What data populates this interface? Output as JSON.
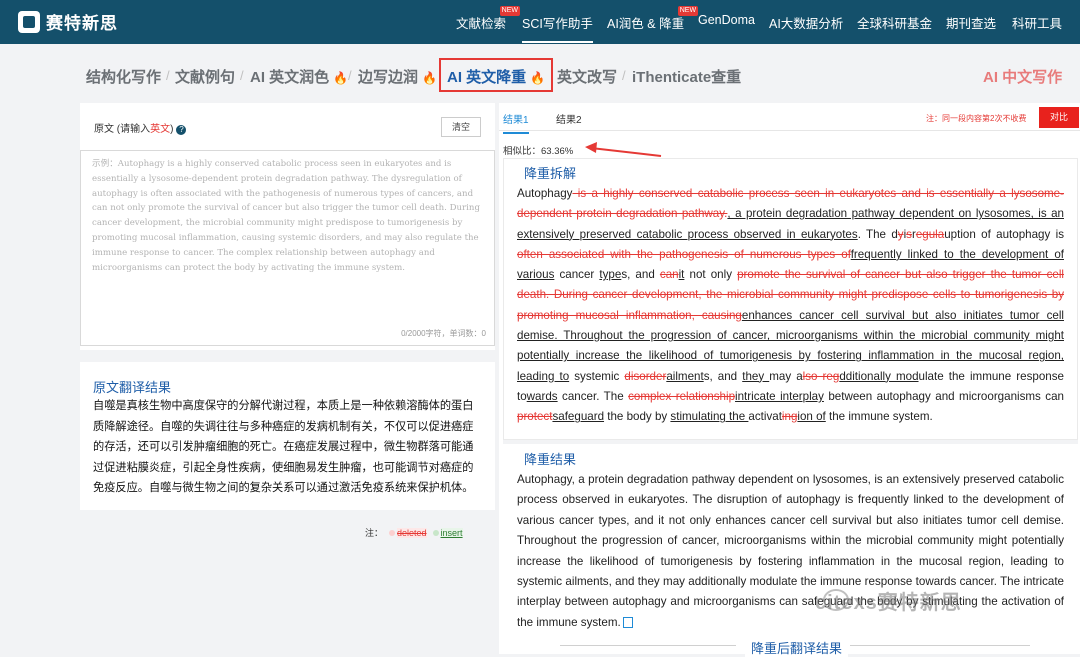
{
  "header": {
    "logo_text": "赛特新思",
    "nav": [
      {
        "label": "文献检索",
        "badge": "NEW"
      },
      {
        "label": "SCI写作助手",
        "active": true
      },
      {
        "label": "AI润色 & 降重",
        "badge": "NEW"
      },
      {
        "label": "GenDoma"
      },
      {
        "label": "AI大数据分析"
      },
      {
        "label": "全球科研基金"
      },
      {
        "label": "期刊查选"
      },
      {
        "label": "科研工具"
      }
    ]
  },
  "tabs": [
    "结构化写作",
    "文献例句",
    "AI 英文润色",
    "边写边润",
    "AI 英文降重",
    "英文改写",
    "iThenticate查重",
    "AI 中文写作"
  ],
  "left": {
    "source_label": "原文 (请输入",
    "source_em": "英文",
    "source_close": ")",
    "clear_label": "清空",
    "placeholder": "示例：Autophagy is a highly conserved catabolic process seen in eukaryotes and is essentially a lysosome-dependent protein degradation pathway. The dysregulation of autophagy is often associated with the pathogenesis of numerous types of cancers, and can not only promote the survival of cancer but also trigger the tumor cell death. During cancer development, the microbial community might predispose to tumorigenesis by promoting mucosal inflammation, causing systemic disorders, and may also regulate the immune response to cancer. The complex relationship between autophagy and microorganisms can protect the body by activating the immune system.",
    "counter": "0/2000字符，单词数：0",
    "translation_title": "原文翻译结果",
    "translation": "自噬是真核生物中高度保守的分解代谢过程，本质上是一种依赖溶酶体的蛋白质降解途径。自噬的失调往往与多种癌症的发病机制有关，不仅可以促进癌症的存活，还可以引发肿瘤细胞的死亡。在癌症发展过程中，微生物群落可能通过促进粘膜炎症，引起全身性疾病，使细胞易发生肿瘤，也可能调节对癌症的免疫反应。自噬与微生物之间的复杂关系可以通过激活免疫系统来保护机体。",
    "legend_note": "注：",
    "legend_deleted": "deleted",
    "legend_insert": "insert"
  },
  "right": {
    "tab1": "结果1",
    "tab2": "结果2",
    "notice": "注：同一段内容第2次不收费",
    "compare_label": "对比",
    "similarity": "相似比：63.36%",
    "diff_title": "降重拆解",
    "result_title": "降重结果",
    "result_text": "Autophagy, a protein degradation pathway dependent on lysosomes, is an extensively preserved catabolic process observed in eukaryotes. The disruption of autophagy is frequently linked to the development of various cancer types, and it not only enhances cancer cell survival but also initiates tumor cell demise. Throughout the progression of cancer, microorganisms within the microbial community might potentially increase the likelihood of tumorigenesis by fostering inflammation in the mucosal region, leading to systemic ailments, and they may additionally modulate the immune response towards cancer. The intricate interplay between autophagy and microorganisms can safeguard the body by stimulating the activation of the immune system.",
    "after_title": "降重后翻译结果"
  },
  "watermark": "citexs赛特新思",
  "colors": {
    "topbar": "#14506b",
    "accent": "#1f5ea8",
    "danger": "#e53935",
    "insert": "#2e7d32"
  }
}
